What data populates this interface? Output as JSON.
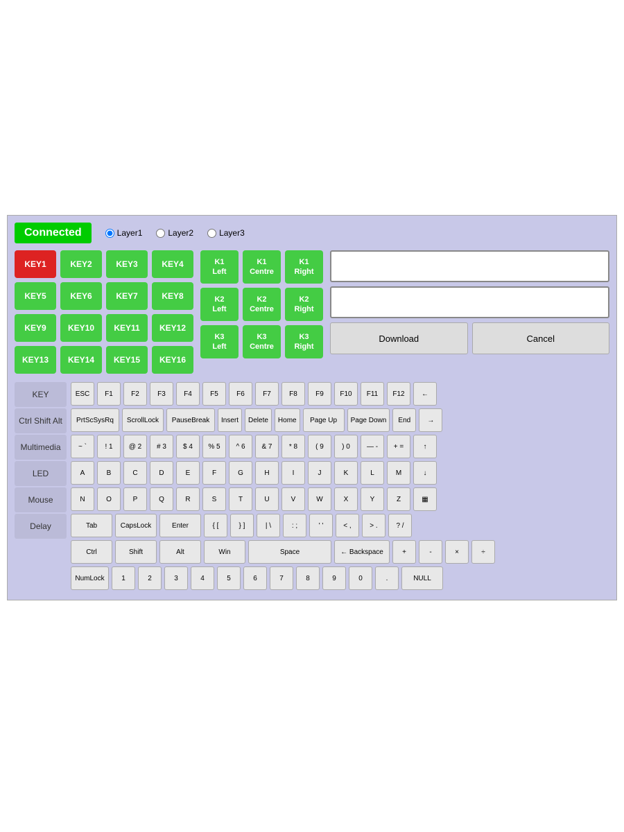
{
  "header": {
    "connected_label": "Connected",
    "layers": [
      {
        "label": "Layer1",
        "checked": true
      },
      {
        "label": "Layer2",
        "checked": false
      },
      {
        "label": "Layer3",
        "checked": false
      }
    ]
  },
  "key_buttons": [
    {
      "label": "KEY1",
      "active": true
    },
    {
      "label": "KEY2",
      "active": false
    },
    {
      "label": "KEY3",
      "active": false
    },
    {
      "label": "KEY4",
      "active": false
    },
    {
      "label": "KEY5",
      "active": false
    },
    {
      "label": "KEY6",
      "active": false
    },
    {
      "label": "KEY7",
      "active": false
    },
    {
      "label": "KEY8",
      "active": false
    },
    {
      "label": "KEY9",
      "active": false
    },
    {
      "label": "KEY10",
      "active": false
    },
    {
      "label": "KEY11",
      "active": false
    },
    {
      "label": "KEY12",
      "active": false
    },
    {
      "label": "KEY13",
      "active": false
    },
    {
      "label": "KEY14",
      "active": false
    },
    {
      "label": "KEY15",
      "active": false
    },
    {
      "label": "KEY16",
      "active": false
    }
  ],
  "k_buttons": [
    {
      "label": "K1\nLeft"
    },
    {
      "label": "K1\nCentre"
    },
    {
      "label": "K1\nRight"
    },
    {
      "label": "K2\nLeft"
    },
    {
      "label": "K2\nCentre"
    },
    {
      "label": "K2\nRight"
    },
    {
      "label": "K3\nLeft"
    },
    {
      "label": "K3\nCentre"
    },
    {
      "label": "K3\nRight"
    }
  ],
  "actions": {
    "download": "Download",
    "cancel": "Cancel"
  },
  "sidebar": {
    "items": [
      {
        "label": "KEY"
      },
      {
        "label": "Ctrl Shift Alt"
      },
      {
        "label": "Multimedia"
      },
      {
        "label": "LED"
      },
      {
        "label": "Mouse"
      },
      {
        "label": "Delay"
      }
    ]
  },
  "keyboard": {
    "rows": [
      [
        "ESC",
        "F1",
        "F2",
        "F3",
        "F4",
        "F5",
        "F6",
        "F7",
        "F8",
        "F9",
        "F10",
        "F11",
        "F12",
        "←"
      ],
      [
        "PrtScSysRq",
        "ScrollLock",
        "PauseBreak",
        "Insert",
        "Delete",
        "Home",
        "Page Up",
        "Page Down",
        "End",
        "→"
      ],
      [
        "~ `",
        "! 1",
        "@ 2",
        "# 3",
        "$ 4",
        "% 5",
        "^ 6",
        "& 7",
        "* 8",
        "( 9",
        ") 0",
        "— -",
        "+ =",
        "↑"
      ],
      [
        "A",
        "B",
        "C",
        "D",
        "E",
        "F",
        "G",
        "H",
        "I",
        "J",
        "K",
        "L",
        "M",
        "↓"
      ],
      [
        "N",
        "O",
        "P",
        "Q",
        "R",
        "S",
        "T",
        "U",
        "V",
        "W",
        "X",
        "Y",
        "Z",
        "▦"
      ],
      [
        "Tab",
        "CapsLock",
        "Enter",
        "{ [",
        "} ]",
        "| \\",
        ": ;",
        "' '",
        "< ,",
        "> .",
        "? /"
      ],
      [
        "Ctrl",
        "Shift",
        "Alt",
        "Win",
        "Space",
        "← Backspace",
        "+",
        "-",
        "×",
        "÷"
      ],
      [
        "NumLock",
        "1",
        "2",
        "3",
        "4",
        "5",
        "6",
        "7",
        "8",
        "9",
        "0",
        ".",
        "NULL"
      ]
    ]
  }
}
